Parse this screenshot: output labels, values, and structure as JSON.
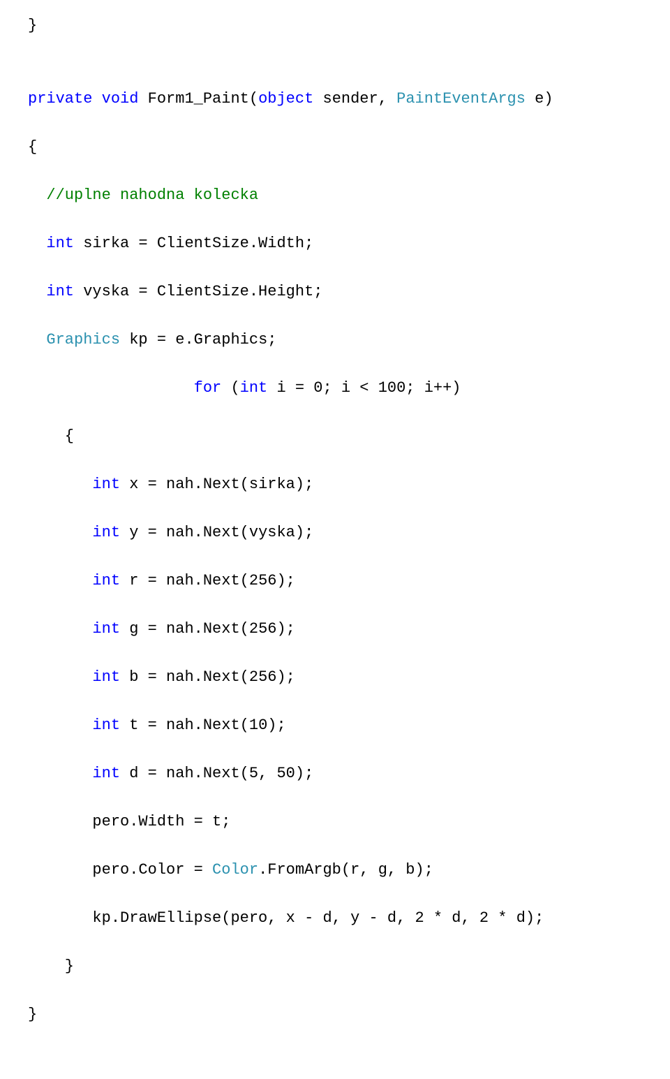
{
  "lines": {
    "l0": "}",
    "l1a": "private",
    "l1b": " ",
    "l1c": "void",
    "l1d": " Form1_Paint(",
    "l1e": "object",
    "l1f": " sender, ",
    "l1g": "PaintEventArgs",
    "l1h": " e)",
    "l2": "{",
    "l3a": "  ",
    "l3b": "//uplne nahodna kolecka",
    "l4a": "  ",
    "l4b": "int",
    "l4c": " sirka = ClientSize.Width;",
    "l5a": "  ",
    "l5b": "int",
    "l5c": " vyska = ClientSize.Height;",
    "l6a": "  ",
    "l6b": "Graphics",
    "l6c": " kp = e.Graphics;",
    "l7a": "                  ",
    "l7b": "for",
    "l7c": " (",
    "l7d": "int",
    "l7e": " i = 0; i < 100; i++)",
    "l8": "    {",
    "l9a": "       ",
    "l9b": "int",
    "l9c": " x = nah.Next(sirka);",
    "l10a": "       ",
    "l10b": "int",
    "l10c": " y = nah.Next(vyska);",
    "l11a": "       ",
    "l11b": "int",
    "l11c": " r = nah.Next(256);",
    "l12a": "       ",
    "l12b": "int",
    "l12c": " g = nah.Next(256);",
    "l13a": "       ",
    "l13b": "int",
    "l13c": " b = nah.Next(256);",
    "l14a": "       ",
    "l14b": "int",
    "l14c": " t = nah.Next(10);",
    "l15a": "       ",
    "l15b": "int",
    "l15c": " d = nah.Next(5, 50);",
    "l16": "       pero.Width = t;",
    "l17a": "       pero.Color = ",
    "l17b": "Color",
    "l17c": ".FromArgb(r, g, b);",
    "l18": "       kp.DrawEllipse(pero, x - d, y - d, 2 * d, 2 * d);",
    "l19": "    }",
    "l20": "}"
  }
}
